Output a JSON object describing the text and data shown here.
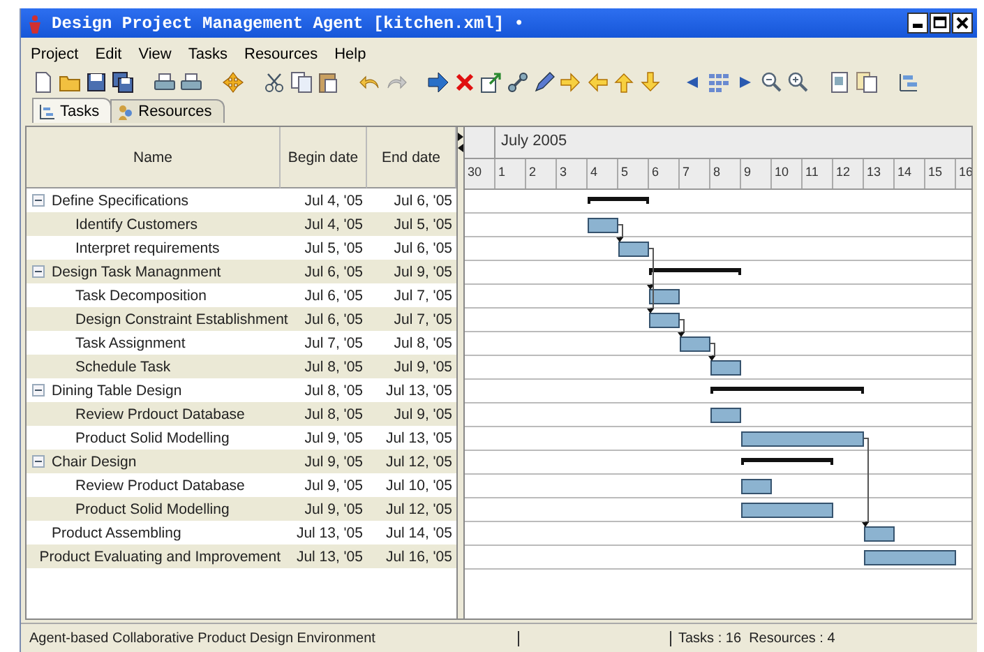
{
  "window": {
    "title": "Design Project Management Agent [kitchen.xml] •"
  },
  "menu": [
    "Project",
    "Edit",
    "View",
    "Tasks",
    "Resources",
    "Help"
  ],
  "tabs": [
    {
      "label": "Tasks",
      "selected": true
    },
    {
      "label": "Resources",
      "selected": false
    }
  ],
  "table": {
    "columns": [
      "Name",
      "Begin date",
      "End date"
    ]
  },
  "gantt": {
    "month": "July 2005",
    "days": [
      "30",
      "1",
      "2",
      "3",
      "4",
      "5",
      "6",
      "7",
      "8",
      "9",
      "10",
      "11",
      "12",
      "13",
      "14",
      "15",
      "16"
    ]
  },
  "tasks": [
    {
      "name": "Define Specifications",
      "begin": "Jul 4, '05",
      "end": "Jul 6, '05",
      "kind": "summary",
      "expanded": true,
      "children": [
        {
          "name": "Identify Customers",
          "begin": "Jul 4, '05",
          "end": "Jul 5, '05",
          "kind": "task",
          "linked": false
        },
        {
          "name": "Interpret requirements",
          "begin": "Jul 5, '05",
          "end": "Jul 6, '05",
          "kind": "task",
          "linked": true
        }
      ]
    },
    {
      "name": "Design Task Managnment",
      "begin": "Jul 6, '05",
      "end": "Jul 9, '05",
      "kind": "summary",
      "expanded": true,
      "children": [
        {
          "name": "Task Decomposition",
          "begin": "Jul 6, '05",
          "end": "Jul 7, '05",
          "kind": "task",
          "linked": true
        },
        {
          "name": "Design Constraint Establishment",
          "begin": "Jul 6, '05",
          "end": "Jul 7, '05",
          "kind": "task",
          "linked": true
        },
        {
          "name": "Task Assignment",
          "begin": "Jul 7, '05",
          "end": "Jul 8, '05",
          "kind": "task",
          "linked": true
        },
        {
          "name": "Schedule Task",
          "begin": "Jul 8, '05",
          "end": "Jul 9, '05",
          "kind": "task",
          "linked": true
        }
      ]
    },
    {
      "name": "Dining Table Design",
      "begin": "Jul 8, '05",
      "end": "Jul 13, '05",
      "kind": "summary",
      "expanded": true,
      "children": [
        {
          "name": "Review Prdouct Database",
          "begin": "Jul 8, '05",
          "end": "Jul 9, '05",
          "kind": "task",
          "linked": false
        },
        {
          "name": "Product Solid Modelling",
          "begin": "Jul 9, '05",
          "end": "Jul 13, '05",
          "kind": "task",
          "linked": false
        }
      ]
    },
    {
      "name": "Chair Design",
      "begin": "Jul 9, '05",
      "end": "Jul 12, '05",
      "kind": "summary",
      "expanded": true,
      "children": [
        {
          "name": "Review Product Database",
          "begin": "Jul 9, '05",
          "end": "Jul 10, '05",
          "kind": "task",
          "linked": false
        },
        {
          "name": "Product Solid Modelling",
          "begin": "Jul 9, '05",
          "end": "Jul 12, '05",
          "kind": "task",
          "linked": false
        }
      ]
    },
    {
      "name": "Product Assembling",
      "begin": "Jul 13, '05",
      "end": "Jul 14, '05",
      "kind": "task",
      "linked": true
    },
    {
      "name": "Product Evaluating and Improvement",
      "begin": "Jul 13, '05",
      "end": "Jul 16, '05",
      "kind": "task",
      "linked": false
    }
  ],
  "status_bar": {
    "message": "Agent-based Collaborative Product Design Environment",
    "summary": "Tasks : 16  Resources : 4"
  }
}
